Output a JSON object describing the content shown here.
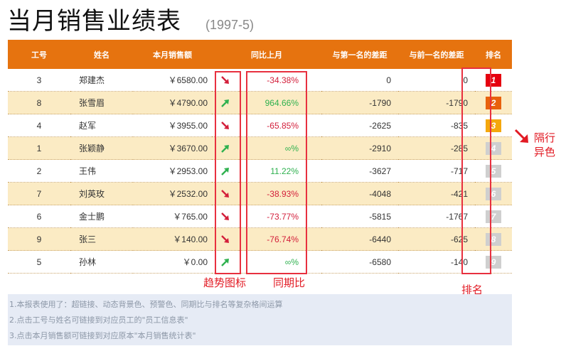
{
  "page": {
    "title": "当月销售业绩表",
    "period": "(1997-5)"
  },
  "colors": {
    "header_bg": "#e6730f",
    "row_alt_bg": "#fbebc4",
    "down": "#d31f3b",
    "up": "#2fb14f",
    "annotation": "#e21b24",
    "notes_bg": "#e6ebf5"
  },
  "table": {
    "headers": [
      "工号",
      "姓名",
      "本月销售额",
      "同比上月",
      "与第一名的差距",
      "与前一名的差距",
      "排名"
    ],
    "rows": [
      {
        "id": "3",
        "name": "郑建杰",
        "sales": "￥6580.00",
        "trend": "down",
        "pct": "-34.38%",
        "gap_first": "0",
        "gap_prev": "0",
        "rank": "1",
        "rank_color": "#e5000f"
      },
      {
        "id": "8",
        "name": "张雪眉",
        "sales": "￥4790.00",
        "trend": "up",
        "pct": "964.66%",
        "gap_first": "-1790",
        "gap_prev": "-1790",
        "rank": "2",
        "rank_color": "#e8610d"
      },
      {
        "id": "4",
        "name": "赵军",
        "sales": "￥3955.00",
        "trend": "down",
        "pct": "-65.85%",
        "gap_first": "-2625",
        "gap_prev": "-835",
        "rank": "3",
        "rank_color": "#f4a80d"
      },
      {
        "id": "1",
        "name": "张颖静",
        "sales": "￥3670.00",
        "trend": "up",
        "pct": "∞%",
        "gap_first": "-2910",
        "gap_prev": "-285",
        "rank": "4",
        "rank_color": "#cfcfcf"
      },
      {
        "id": "2",
        "name": "王伟",
        "sales": "￥2953.00",
        "trend": "up",
        "pct": "11.22%",
        "gap_first": "-3627",
        "gap_prev": "-717",
        "rank": "5",
        "rank_color": "#cfcfcf"
      },
      {
        "id": "7",
        "name": "刘英玫",
        "sales": "￥2532.00",
        "trend": "down",
        "pct": "-38.93%",
        "gap_first": "-4048",
        "gap_prev": "-421",
        "rank": "6",
        "rank_color": "#cfcfcf"
      },
      {
        "id": "6",
        "name": "金士鹏",
        "sales": "￥765.00",
        "trend": "down",
        "pct": "-73.77%",
        "gap_first": "-5815",
        "gap_prev": "-1767",
        "rank": "7",
        "rank_color": "#cfcfcf"
      },
      {
        "id": "9",
        "name": "张三",
        "sales": "￥140.00",
        "trend": "down",
        "pct": "-76.74%",
        "gap_first": "-6440",
        "gap_prev": "-625",
        "rank": "8",
        "rank_color": "#cfcfcf"
      },
      {
        "id": "5",
        "name": "孙林",
        "sales": "￥0.00",
        "trend": "up",
        "pct": "∞%",
        "gap_first": "-6580",
        "gap_prev": "-140",
        "rank": "9",
        "rank_color": "#cfcfcf"
      }
    ]
  },
  "annotations": {
    "trend_icon": "趋势图标",
    "yoy": "同期比",
    "rank": "排名",
    "alt_rows_line1": "隔行",
    "alt_rows_line2": "异色"
  },
  "notes": [
    "1.本报表使用了：超链接、动态背景色、预警色、同期比与排名等复杂格间运算",
    "2.点击工号与姓名可链接到对应员工的\"员工信息表\"",
    "3.点击本月销售额可链接到对应原本\"本月销售统计表\""
  ]
}
